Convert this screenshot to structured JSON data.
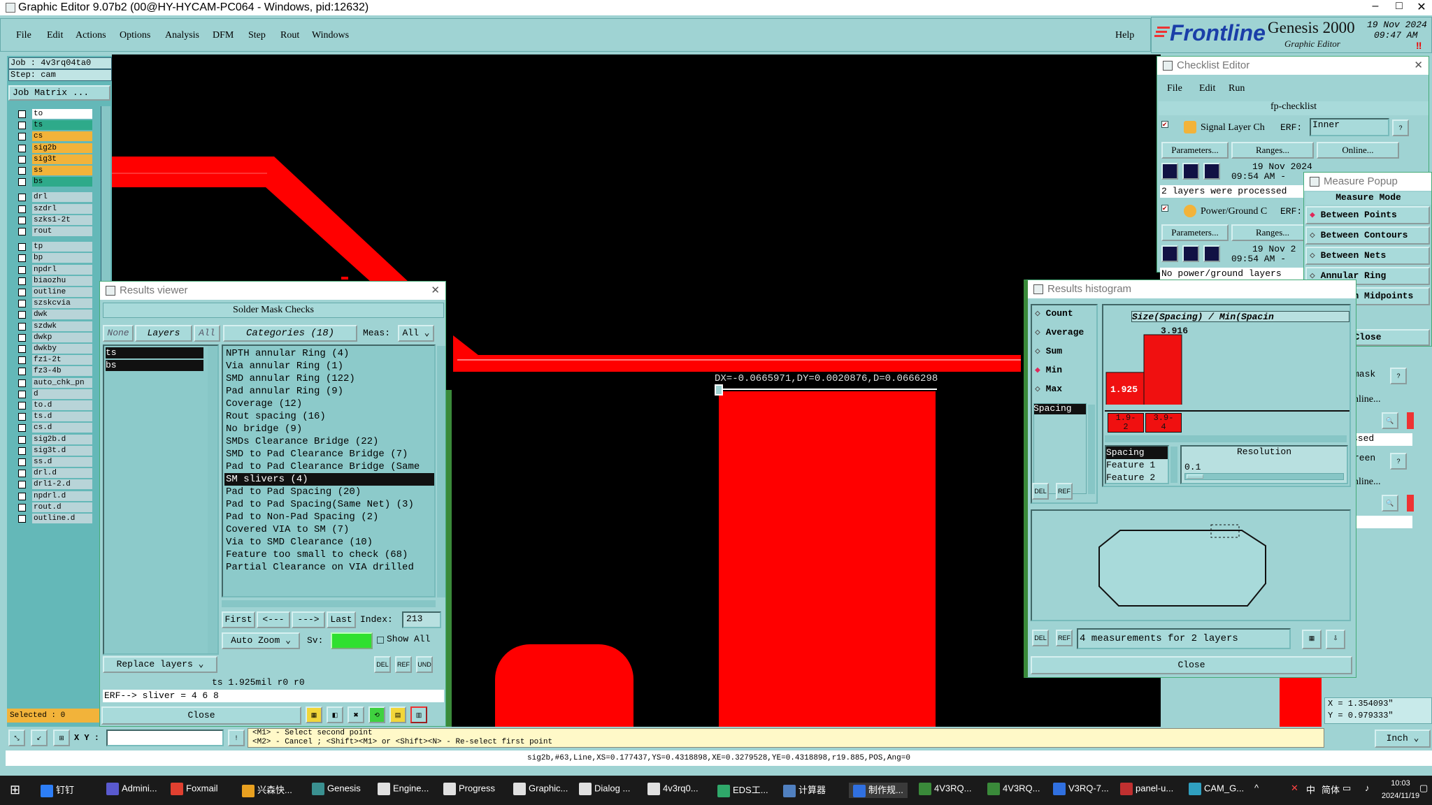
{
  "window": {
    "title": "Graphic Editor 9.07b2 (00@HY-HYCAM-PC064 - Windows, pid:12632)"
  },
  "menu": [
    "File",
    "Edit",
    "Actions",
    "Options",
    "Analysis",
    "DFM",
    "Step",
    "Rout",
    "Windows"
  ],
  "help": "Help",
  "brand": {
    "name": "Frontline",
    "product": "Genesis 2000",
    "subtitle": "Graphic Editor",
    "date": "19 Nov 2024",
    "time": "09:47 AM"
  },
  "job": {
    "job": "Job : 4v3rq04ta0",
    "step": "Step: cam",
    "matrix": "Job Matrix ..."
  },
  "layers": [
    {
      "name": "to",
      "color": "#ffffff"
    },
    {
      "name": "ts",
      "color": "#2eaa8a"
    },
    {
      "name": "cs",
      "color": "#f2b33a"
    },
    {
      "name": "sig2b",
      "color": "#f2b33a"
    },
    {
      "name": "sig3t",
      "color": "#f2b33a"
    },
    {
      "name": "ss",
      "color": "#f2b33a"
    },
    {
      "name": "bs",
      "color": "#2eaa8a"
    },
    {
      "name": "drl",
      "color": "#b8d4d8"
    },
    {
      "name": "szdrl",
      "color": "#b8d4d8"
    },
    {
      "name": "szks1-2t",
      "color": "#b8d4d8"
    },
    {
      "name": "rout",
      "color": "#b8d4d8"
    },
    {
      "name": "tp",
      "color": "#b8d4d8"
    },
    {
      "name": "bp",
      "color": "#b8d4d8"
    },
    {
      "name": "npdrl",
      "color": "#b8d4d8"
    },
    {
      "name": "biaozhu",
      "color": "#b8d4d8"
    },
    {
      "name": "outline",
      "color": "#b8d4d8"
    },
    {
      "name": "szskcvia",
      "color": "#b8d4d8"
    },
    {
      "name": "dwk",
      "color": "#b8d4d8"
    },
    {
      "name": "szdwk",
      "color": "#b8d4d8"
    },
    {
      "name": "dwkp",
      "color": "#b8d4d8"
    },
    {
      "name": "dwkby",
      "color": "#b8d4d8"
    },
    {
      "name": "fz1-2t",
      "color": "#b8d4d8"
    },
    {
      "name": "fz3-4b",
      "color": "#b8d4d8"
    },
    {
      "name": "auto_chk_pn",
      "color": "#b8d4d8"
    },
    {
      "name": "d",
      "color": "#b8d4d8"
    },
    {
      "name": "to.d",
      "color": "#b8d4d8"
    },
    {
      "name": "ts.d",
      "color": "#b8d4d8"
    },
    {
      "name": "cs.d",
      "color": "#b8d4d8"
    },
    {
      "name": "sig2b.d",
      "color": "#b8d4d8"
    },
    {
      "name": "sig3t.d",
      "color": "#b8d4d8"
    },
    {
      "name": "ss.d",
      "color": "#b8d4d8"
    },
    {
      "name": "drl.d",
      "color": "#b8d4d8"
    },
    {
      "name": "drl1-2.d",
      "color": "#b8d4d8"
    },
    {
      "name": "npdrl.d",
      "color": "#b8d4d8"
    },
    {
      "name": "rout.d",
      "color": "#b8d4d8"
    },
    {
      "name": "outline.d",
      "color": "#b8d4d8"
    }
  ],
  "selected": "Selected : 0",
  "xy_label": "X Y :",
  "measure_readout": "DX=-0.0665971,DY=0.0020876,D=0.0666298",
  "results_viewer": {
    "title": "Results viewer",
    "header": "Solder Mask Checks",
    "none": "None",
    "layers": "Layers",
    "all": "All",
    "categories_label": "Categories (18)",
    "meas_label": "Meas:",
    "meas_value": "All",
    "layer_list": [
      "ts",
      "bs"
    ],
    "categories": [
      "NPTH annular Ring (4)",
      "Via annular Ring (1)",
      "SMD annular Ring (122)",
      "Pad annular Ring (9)",
      "Coverage (12)",
      "Rout spacing (16)",
      "No bridge (9)",
      "SMDs Clearance Bridge (22)",
      "SMD to Pad Clearance Bridge (7)",
      "Pad to Pad Clearance Bridge (Same",
      "SM slivers (4)",
      "Pad to Pad Spacing (20)",
      "Pad to Pad Spacing(Same Net) (3)",
      "Pad to Non-Pad Spacing (2)",
      "Covered VIA to SM (7)",
      "Via to SMD Clearance (10)",
      "Feature too small to check (68)",
      "Partial Clearance on VIA drilled"
    ],
    "first": "First",
    "prev": "<---",
    "next": "--->",
    "last": "Last",
    "index_label": "Index:",
    "index_value": "213",
    "auto_zoom": "Auto Zoom",
    "sv": "Sv:",
    "show_all": "Show All",
    "replace_layers": "Replace layers",
    "info": "ts 1.925mil  r0  r0",
    "erf": "ERF--> sliver = 4 6 8",
    "close": "Close"
  },
  "prompt": {
    "line1": "<M1> - Select second point",
    "line2": "<M2> - Cancel ; <Shift><M1> or <Shift><N> - Re-select first point"
  },
  "checklist": {
    "title": "Checklist Editor",
    "menu": [
      "File",
      "Edit",
      "Run"
    ],
    "name": "fp-checklist",
    "items": [
      {
        "name": "Signal Layer Ch",
        "erf": "ERF:",
        "erf_value": "Inner",
        "date": "19 Nov 2024",
        "time": "09:54 AM -",
        "msg": "2 layers were processed"
      },
      {
        "name": "Power/Ground C",
        "erf": "ERF:",
        "erf_value": "",
        "date": "19 Nov 2",
        "time": "09:54 AM -",
        "msg": "No power/ground layers"
      }
    ],
    "params": "Parameters...",
    "ranges": "Ranges...",
    "online": "Online...",
    "partial": [
      "mask",
      "nline...",
      "ssed",
      "reen",
      "nline..."
    ]
  },
  "measure_popup": {
    "title": "Measure Popup",
    "mode_label": "Measure Mode",
    "modes": [
      "Between Points",
      "Between Contours",
      "Between Nets",
      "Annular Ring",
      "Between Midpoints"
    ],
    "close": "Close"
  },
  "histogram": {
    "title": "Results histogram",
    "stats": [
      "Count",
      "Average",
      "Sum",
      "Min",
      "Max"
    ],
    "list_item": "Spacing",
    "chart_title": "Size(Spacing) / Min(Spacin",
    "x_labels": [
      "1.9-\n2",
      "3.9-\n4"
    ],
    "values": [
      1.925,
      3.916
    ],
    "value_labels": [
      "1.925",
      "3.916"
    ],
    "resolution_label": "Resolution",
    "resolution_value": "0.1",
    "feature_list": [
      "Spacing",
      "Feature 1",
      "Feature 2"
    ],
    "footer": "4 measurements for 2 layers",
    "close": "Close"
  },
  "coords": {
    "x": "X = 1.354093\"",
    "y": "Y = 0.979333\""
  },
  "units": "Inch",
  "statusline": "sig2b,#63,Line,XS=0.177437,YS=0.4318898,XE=0.3279528,YE=0.4318898,r19.885,POS,Ang=0",
  "taskbar": {
    "items": [
      "钉钉",
      "Admini...",
      "Foxmail",
      "兴森快...",
      "Genesis",
      "Engine...",
      "Progress",
      "Graphic...",
      "Dialog ...",
      "4v3rq0...",
      "EDS工...",
      "计算器",
      "制作规...",
      "4V3RQ...",
      "4V3RQ...",
      "V3RQ-7...",
      "panel-u...",
      "CAM_G..."
    ],
    "ime": "中",
    "ime2": "简体",
    "time": "10:03",
    "date": "2024/11/19"
  }
}
